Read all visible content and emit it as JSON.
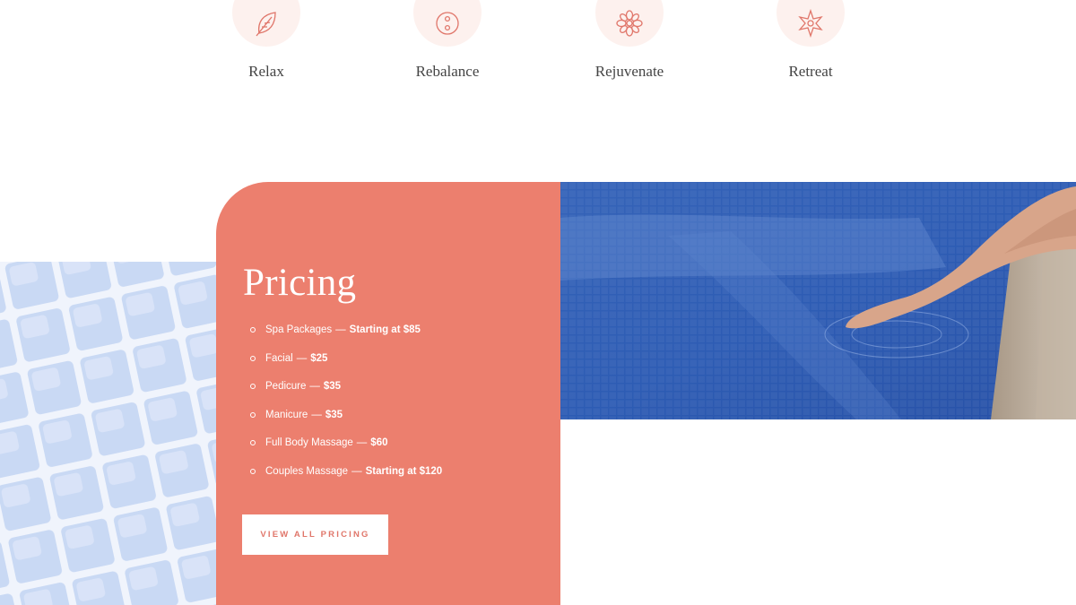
{
  "features": [
    {
      "label": "Relax",
      "icon": "leaf-icon"
    },
    {
      "label": "Rebalance",
      "icon": "button-icon"
    },
    {
      "label": "Rejuvenate",
      "icon": "flower-icon"
    },
    {
      "label": "Retreat",
      "icon": "star-icon"
    }
  ],
  "pricing": {
    "title": "Pricing",
    "items": [
      {
        "service": "Spa Packages",
        "price": "Starting at $85"
      },
      {
        "service": "Facial",
        "price": "$25"
      },
      {
        "service": "Pedicure",
        "price": "$35"
      },
      {
        "service": "Manicure",
        "price": "$35"
      },
      {
        "service": "Full Body Massage",
        "price": "$60"
      },
      {
        "service": "Couples Massage",
        "price": "Starting at $120"
      }
    ],
    "dash": "—",
    "button_label": "VIEW ALL PRICING"
  },
  "colors": {
    "accent": "#ec7f6e",
    "icon_bg": "#fdf1ee",
    "icon_stroke": "#e0766a",
    "pool_blue": "#2f5fb8",
    "tile_blue": "#d4e0f6"
  },
  "images": {
    "pool_photo": "photo of a foot dipping into a blue mosaic-tiled pool",
    "tile_texture": "pale blue mosaic tiles"
  }
}
